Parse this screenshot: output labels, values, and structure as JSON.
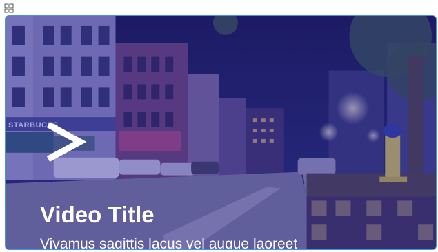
{
  "toolbar": {
    "drag_icon": "grid-move-icon"
  },
  "card": {
    "title": "Video Title",
    "description": "Vivamus sagittis lacus vel augue laoreet",
    "play_icon": "chevron-right-icon",
    "overlay_color": "#3730aa",
    "border_color": "#4a90e2"
  },
  "scene": {
    "store_sign": "STARBUCKS"
  }
}
